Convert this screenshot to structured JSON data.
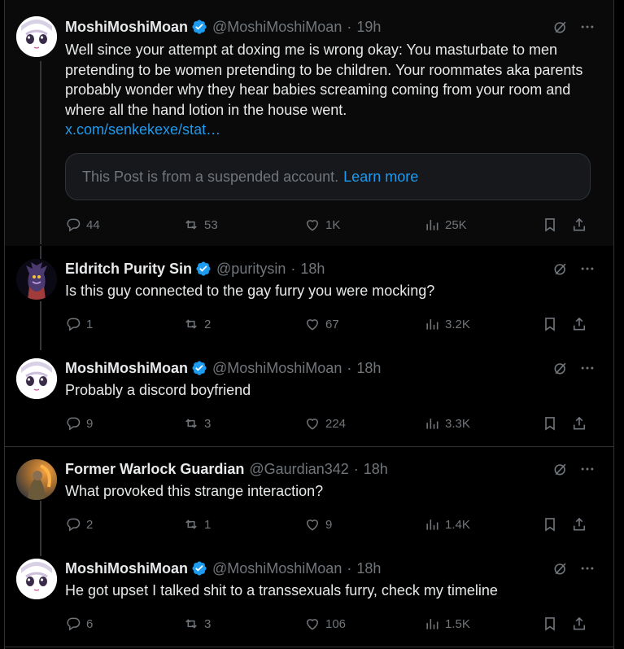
{
  "posts": [
    {
      "name": "MoshiMoshiMoan",
      "handle": "@MoshiMoshiMoan",
      "time": "19h",
      "text": "Well since your attempt at doxing me is wrong okay: You masturbate to men pretending to be women pretending to be children.  Your roommates aka parents probably wonder why they hear babies screaming coming from your room and where all the hand lotion in the house went.",
      "link": "x.com/senkekexe/stat…",
      "quote_text": "This Post is from a suspended account.",
      "quote_link": "Learn more",
      "replies": "44",
      "reposts": "53",
      "likes": "1K",
      "views": "25K"
    },
    {
      "name": "Eldritch Purity Sin",
      "handle": "@puritysin",
      "time": "18h",
      "text": "Is this guy connected to the gay furry you were mocking?",
      "replies": "1",
      "reposts": "2",
      "likes": "67",
      "views": "3.2K"
    },
    {
      "name": "MoshiMoshiMoan",
      "handle": "@MoshiMoshiMoan",
      "time": "18h",
      "text": "Probably a discord boyfriend",
      "replies": "9",
      "reposts": "3",
      "likes": "224",
      "views": "3.3K"
    },
    {
      "name": "Former Warlock Guardian",
      "handle": "@Gaurdian342",
      "time": "18h",
      "text": "What provoked this strange interaction?",
      "replies": "2",
      "reposts": "1",
      "likes": "9",
      "views": "1.4K"
    },
    {
      "name": "MoshiMoshiMoan",
      "handle": "@MoshiMoshiMoan",
      "time": "18h",
      "text": "He got upset I talked shit to a transsexuals furry, check my timeline",
      "replies": "6",
      "reposts": "3",
      "likes": "106",
      "views": "1.5K"
    }
  ],
  "separator": "·",
  "colors": {
    "background": "#000000",
    "text": "#e7e9ea",
    "muted": "#71767b",
    "link": "#1d9bf0",
    "verified": "#1d9bf0",
    "border": "#2f3336"
  },
  "icons": [
    "verified-badge-icon",
    "grok-icon",
    "more-icon",
    "reply-icon",
    "repost-icon",
    "like-icon",
    "views-icon",
    "bookmark-icon",
    "share-icon"
  ]
}
